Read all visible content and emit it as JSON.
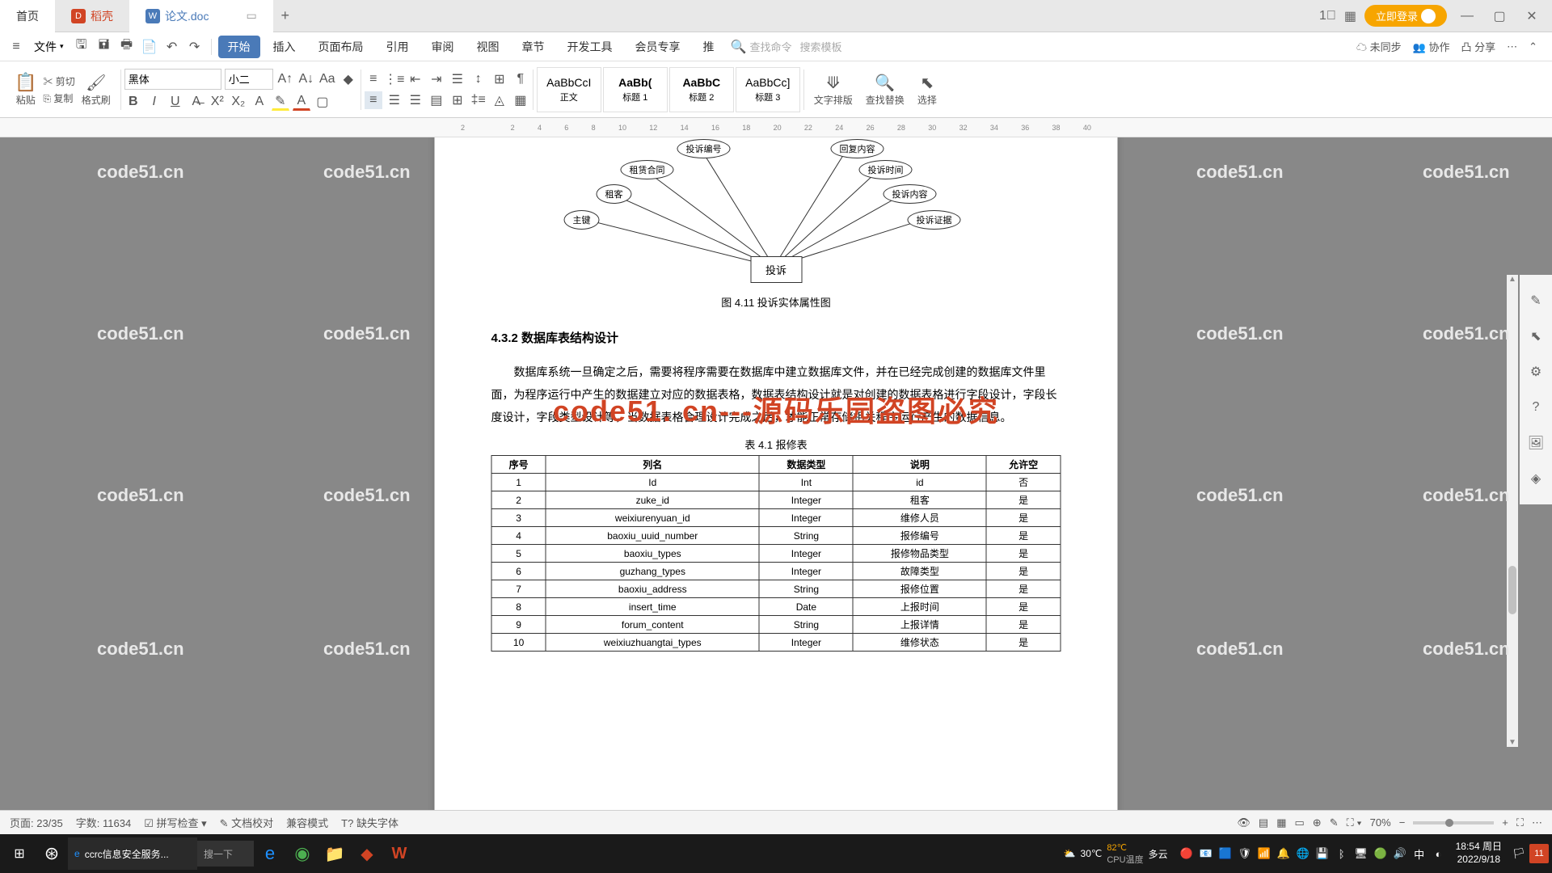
{
  "titlebar": {
    "home": "首页",
    "docer": "稻壳",
    "active_doc": "论文.doc",
    "login": "立即登录"
  },
  "menubar": {
    "file": "文件",
    "tabs": [
      "开始",
      "插入",
      "页面布局",
      "引用",
      "审阅",
      "视图",
      "章节",
      "开发工具",
      "会员专享",
      "推"
    ],
    "search_cmd": "查找命令",
    "search_tpl": "搜索模板",
    "unsync": "未同步",
    "coop": "协作",
    "share": "分享"
  },
  "ribbon": {
    "paste": "粘贴",
    "cut": "剪切",
    "copy": "复制",
    "format_painter": "格式刷",
    "font_name": "黑体",
    "font_size": "小二",
    "styles": [
      {
        "preview": "AaBbCcI",
        "name": "正文"
      },
      {
        "preview": "AaBb(",
        "name": "标题 1",
        "bold": true
      },
      {
        "preview": "AaBbC",
        "name": "标题 2",
        "bold": true
      },
      {
        "preview": "AaBbCc]",
        "name": "标题 3"
      }
    ],
    "text_layout": "文字排版",
    "find_replace": "查找替换",
    "select": "选择"
  },
  "ruler_marks": [
    "2",
    "",
    "2",
    "4",
    "6",
    "8",
    "10",
    "12",
    "14",
    "16",
    "18",
    "20",
    "22",
    "24",
    "26",
    "28",
    "30",
    "32",
    "34",
    "36",
    "38",
    "40"
  ],
  "document": {
    "diagram": {
      "center": "投诉",
      "bubbles": [
        "主键",
        "租客",
        "租赁合同",
        "投诉编号",
        "回复内容",
        "投诉时间",
        "投诉内容",
        "投诉证据"
      ]
    },
    "fig_caption": "图 4.11 投诉实体属性图",
    "sec_title": "4.3.2  数据库表结构设计",
    "para": "数据库系统一旦确定之后，需要将程序需要在数据库中建立数据库文件，并在已经完成创建的数据库文件里面，为程序运行中产生的数据建立对应的数据表格，数据表结构设计就是对创建的数据表格进行字段设计，字段长度设计，字段类型设计等，当数据表格合理设计完成之后，才能正常存储相关程序运行产生的数据信息。",
    "table_caption": "表 4.1 报修表",
    "table": {
      "headers": [
        "序号",
        "列名",
        "数据类型",
        "说明",
        "允许空"
      ],
      "rows": [
        [
          "1",
          "Id",
          "Int",
          "id",
          "否"
        ],
        [
          "2",
          "zuke_id",
          "Integer",
          "租客",
          "是"
        ],
        [
          "3",
          "weixiurenyuan_id",
          "Integer",
          "维修人员",
          "是"
        ],
        [
          "4",
          "baoxiu_uuid_number",
          "String",
          "报修编号",
          "是"
        ],
        [
          "5",
          "baoxiu_types",
          "Integer",
          "报修物品类型",
          "是"
        ],
        [
          "6",
          "guzhang_types",
          "Integer",
          "故障类型",
          "是"
        ],
        [
          "7",
          "baoxiu_address",
          "String",
          "报修位置",
          "是"
        ],
        [
          "8",
          "insert_time",
          "Date",
          "上报时间",
          "是"
        ],
        [
          "9",
          "forum_content",
          "String",
          "上报详情",
          "是"
        ],
        [
          "10",
          "weixiuzhuangtai_types",
          "Integer",
          "维修状态",
          "是"
        ]
      ]
    },
    "watermark_big": "code51. cn---源码乐园盗图必究",
    "watermark_small": "code51.cn"
  },
  "statusbar": {
    "page": "页面: 23/35",
    "words": "字数: 11634",
    "spell": "拼写检查",
    "proof": "文档校对",
    "compat": "兼容模式",
    "missing_font": "缺失字体",
    "zoom": "70%"
  },
  "taskbar": {
    "app_label": "ccrc信息安全服务...",
    "search": "搜一下",
    "weather_temp": "30℃",
    "weather_txt": "多云",
    "cpu_temp": "82℃",
    "cpu_label": "CPU温度",
    "time": "18:54",
    "day": "周日",
    "date": "2022/9/18",
    "notif": "11"
  }
}
